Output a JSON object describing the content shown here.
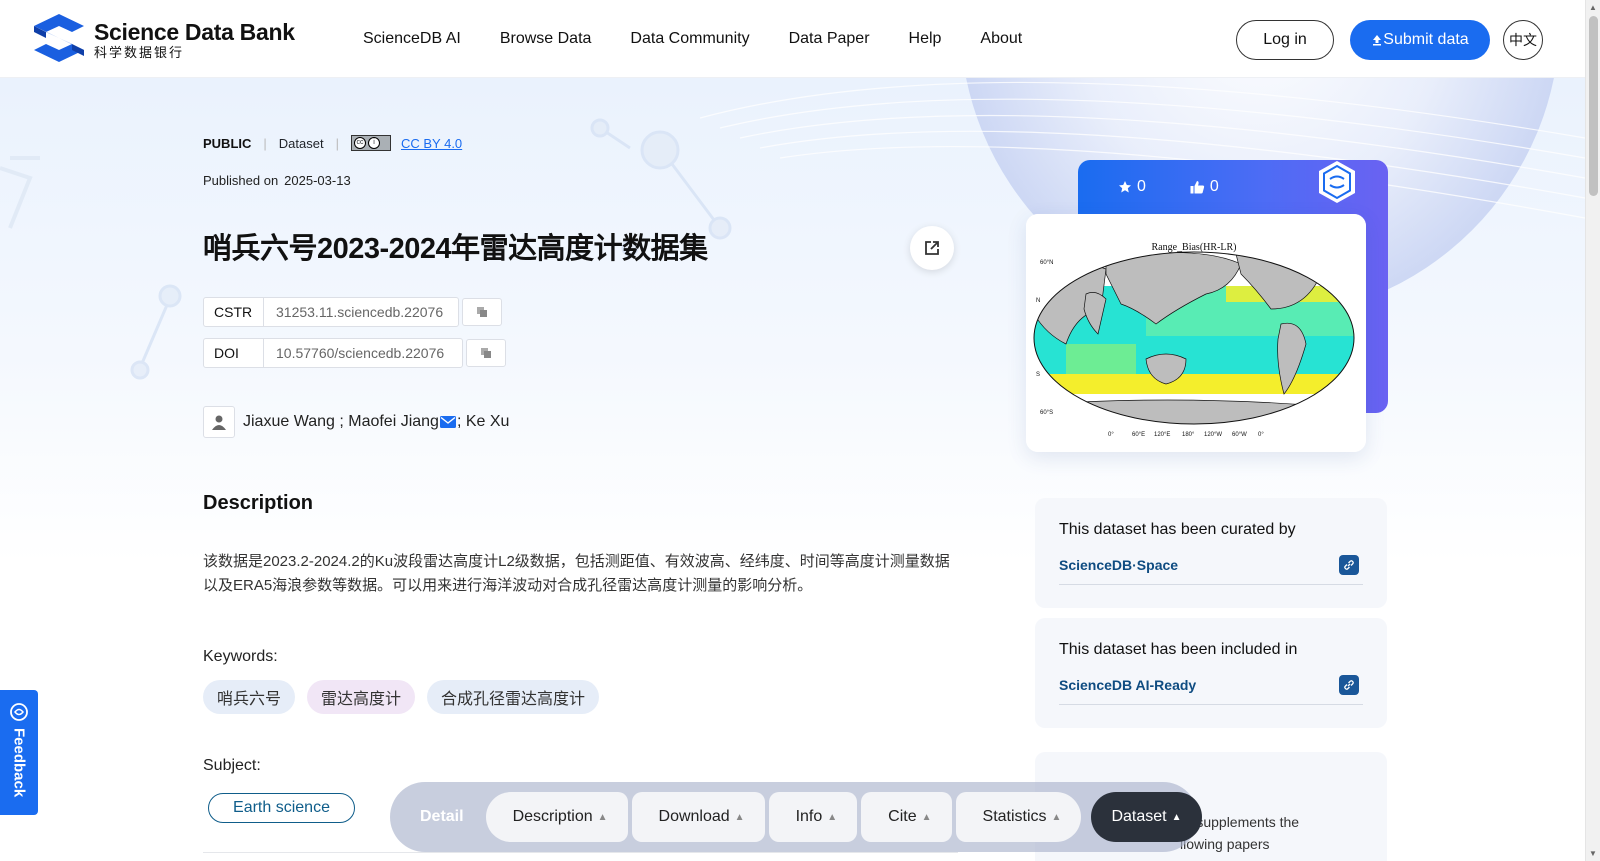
{
  "header": {
    "logo_en": "Science Data Bank",
    "logo_cn": "科学数据银行",
    "nav": [
      "ScienceDB AI",
      "Browse Data",
      "Data Community",
      "Data Paper",
      "Help",
      "About"
    ],
    "login_label": "Log in",
    "submit_label": "Submit data",
    "lang_label": "中文"
  },
  "dataset": {
    "visibility": "PUBLIC",
    "type": "Dataset",
    "license": "CC BY 4.0",
    "published_label": "Published on",
    "published_date": "2025-03-13",
    "title": "哨兵六号2023-2024年雷达高度计数据集",
    "cstr_label": "CSTR",
    "cstr_value": "31253.11.sciencedb.22076",
    "doi_label": "DOI",
    "doi_value": "10.57760/sciencedb.22076",
    "authors": {
      "a1": "Jiaxue Wang ; Maofei Jiang",
      "a2": "; Ke Xu"
    },
    "description_heading": "Description",
    "description": "该数据是2023.2-2024.2的Ku波段雷达高度计L2级数据，包括测距值、有效波高、经纬度、时间等高度计测量数据以及ERA5海浪参数等数据。可以用来进行海洋波动对合成孔径雷达高度计测量的影响分析。",
    "keywords_label": "Keywords:",
    "keywords": [
      "哨兵六号",
      "雷达高度计",
      "合成孔径雷达高度计"
    ],
    "subject_label": "Subject:",
    "subject": "Earth science"
  },
  "stats": {
    "stars": "0",
    "likes": "0"
  },
  "preview": {
    "title": "Range_Bias(HR-LR)",
    "lat_labels": [
      "60°N",
      "N",
      "S",
      "60°S"
    ],
    "lon_labels": [
      "0°",
      "60°E",
      "120°E",
      "180°",
      "120°W",
      "60°W",
      "0°"
    ]
  },
  "curated": {
    "text": "This dataset has been curated by",
    "link": "ScienceDB·Space"
  },
  "included": {
    "text": "This dataset has been included in",
    "link": "ScienceDB AI-Ready"
  },
  "related": {
    "line1": "or supplements the",
    "line2": "llowing papers"
  },
  "feedback_label": "Feedback",
  "dock": {
    "label": "Detail",
    "items": [
      "Description",
      "Download",
      "Info",
      "Cite",
      "Statistics"
    ],
    "active": "Dataset"
  },
  "colors": {
    "brand": "#1a6cf0",
    "dark_link": "#0f4c81"
  }
}
